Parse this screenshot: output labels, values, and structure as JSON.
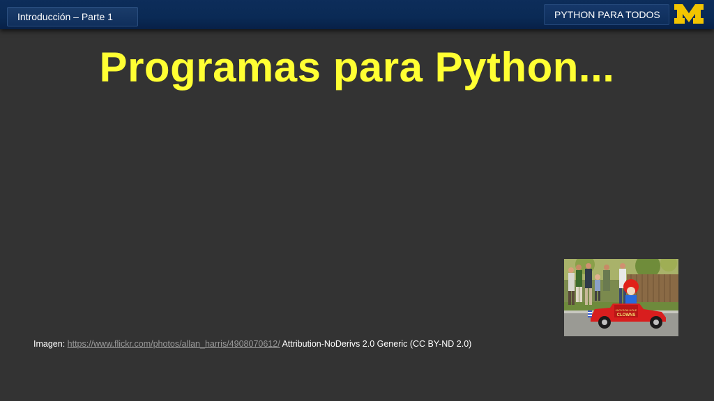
{
  "header": {
    "section_label": "Introducción – Parte 1",
    "course_label": "PYTHON PARA TODOS",
    "logo_letter": "M",
    "logo_color": "#f2c400"
  },
  "slide": {
    "title": "Programas para Python...",
    "title_color": "#ffff33"
  },
  "caption": {
    "prefix": "Imagen: ",
    "link_text": "https://www.flickr.com/photos/allan_harris/4908070612/",
    "suffix": " Attribution-NoDerivs 2.0 Generic (CC BY-ND 2.0)"
  },
  "photo": {
    "car_sign": "CLOWNS"
  }
}
